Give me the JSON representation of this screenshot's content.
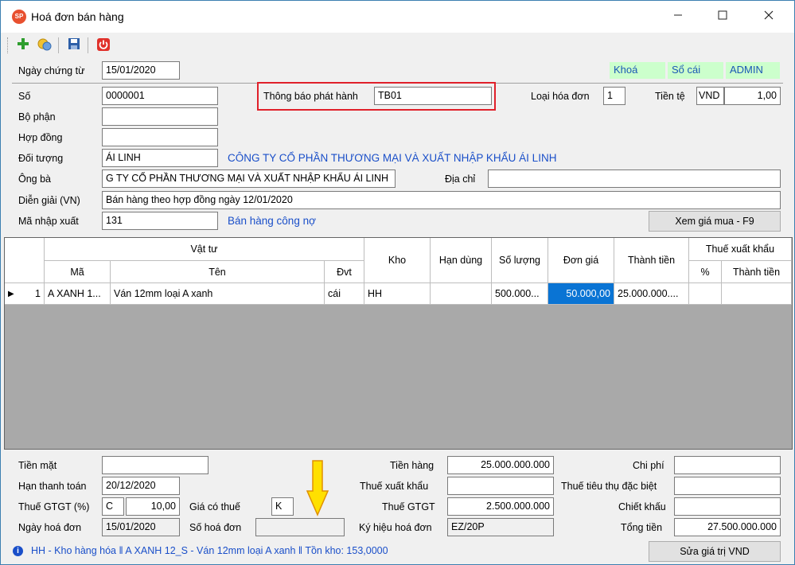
{
  "window": {
    "title": "Hoá đơn bán hàng",
    "app_icon_text": "SP"
  },
  "toolbar": {
    "icons": [
      "plus-icon",
      "coins-icon",
      "save-icon",
      "power-icon"
    ]
  },
  "header": {
    "ngay_chung_tu_label": "Ngày chứng từ",
    "ngay_chung_tu": "15/01/2020",
    "tags": [
      "Khoá",
      "Sổ cái",
      "ADMIN"
    ]
  },
  "form": {
    "so_label": "Số",
    "so": "0000001",
    "thong_bao_label": "Thông báo phát hành",
    "thong_bao": "TB01",
    "loai_hoa_don_label": "Loại hóa đơn",
    "loai_hoa_don": "1",
    "tien_te_label": "Tiền tệ",
    "tien_te": "VND",
    "ty_gia": "1,00",
    "bo_phan_label": "Bộ phận",
    "bo_phan": "",
    "hop_dong_label": "Hợp đồng",
    "hop_dong": "",
    "doi_tuong_label": "Đối tượng",
    "doi_tuong": "ÁI LINH",
    "doi_tuong_name": "CÔNG TY CỔ PHẦN THƯƠNG MẠI VÀ XUẤT NHẬP KHẨU ÁI LINH",
    "ong_ba_label": "Ông bà",
    "ong_ba": "G TY CỔ PHẦN THƯƠNG MẠI VÀ XUẤT NHẬP KHẨU ÁI LINH",
    "dia_chi_label": "Địa chỉ",
    "dia_chi": "",
    "dien_giai_label": "Diễn giải (VN)",
    "dien_giai": "Bán hàng theo hợp đồng ngày 12/01/2020",
    "ma_nhap_xuat_label": "Mã nhập xuất",
    "ma_nhap_xuat": "131",
    "ma_nhap_xuat_desc": "Bán hàng công nợ",
    "xem_gia_mua": "Xem giá mua - F9"
  },
  "grid": {
    "headers": {
      "vat_tu": "Vật tư",
      "ma": "Mã",
      "ten": "Tên",
      "dvt": "Đvt",
      "kho": "Kho",
      "han_dung": "Hạn dùng",
      "so_luong": "Số lượng",
      "don_gia": "Đơn giá",
      "thanh_tien": "Thành tiền",
      "thue_xk": "Thuế xuất khẩu",
      "pct": "%",
      "thue_thanh_tien": "Thành tiền"
    },
    "rows": [
      {
        "indicator": "▶",
        "stt": "1",
        "ma": "A XANH 1...",
        "ten": "Ván 12mm loại A xanh",
        "dvt": "cái",
        "kho": "HH",
        "han_dung": "",
        "so_luong": "500.000...",
        "don_gia": "50.000,00",
        "thanh_tien": "25.000.000....",
        "pct": "",
        "thue_thanh_tien": ""
      }
    ]
  },
  "footer": {
    "tien_mat_label": "Tiền mặt",
    "tien_mat": "",
    "han_thanh_toan_label": "Hạn thanh toán",
    "han_thanh_toan": "20/12/2020",
    "thue_gtgt_pct_label": "Thuế GTGT (%)",
    "thue_gtgt_code": "C",
    "thue_gtgt_pct": "10,00",
    "gia_co_thue_label": "Giá có thuế",
    "gia_co_thue": "K",
    "ngay_hoa_don_label": "Ngày hoá đơn",
    "ngay_hoa_don": "15/01/2020",
    "so_hoa_don_label": "Số hoá đơn",
    "so_hoa_don": "",
    "tien_hang_label": "Tiền hàng",
    "tien_hang": "25.000.000.000",
    "thue_xuat_khau_label": "Thuế xuất khẩu",
    "thue_xuat_khau": "",
    "thue_gtgt_label": "Thuế GTGT",
    "thue_gtgt": "2.500.000.000",
    "ky_hieu_label": "Ký hiệu hoá đơn",
    "ky_hieu": "EZ/20P",
    "chi_phi_label": "Chi phí",
    "chi_phi": "",
    "thue_ttdb_label": "Thuế tiêu thụ đặc biệt",
    "thue_ttdb": "",
    "chiet_khau_label": "Chiết khấu",
    "chiet_khau": "",
    "tong_tien_label": "Tổng tiền",
    "tong_tien": "27.500.000.000",
    "sua_gia_tri": "Sửa giá trị VND"
  },
  "status": {
    "text": "HH - Kho hàng hóa ‖ A XANH 12_S - Ván 12mm loại A xanh ‖ Tồn kho: 153,0000"
  },
  "colors": {
    "accent_blue": "#1a4fc9",
    "highlight_red": "#e0202a",
    "selected_cell": "#0a74d4",
    "tag_bg": "#ccffcc",
    "arrow_yellow": "#ffe000"
  }
}
